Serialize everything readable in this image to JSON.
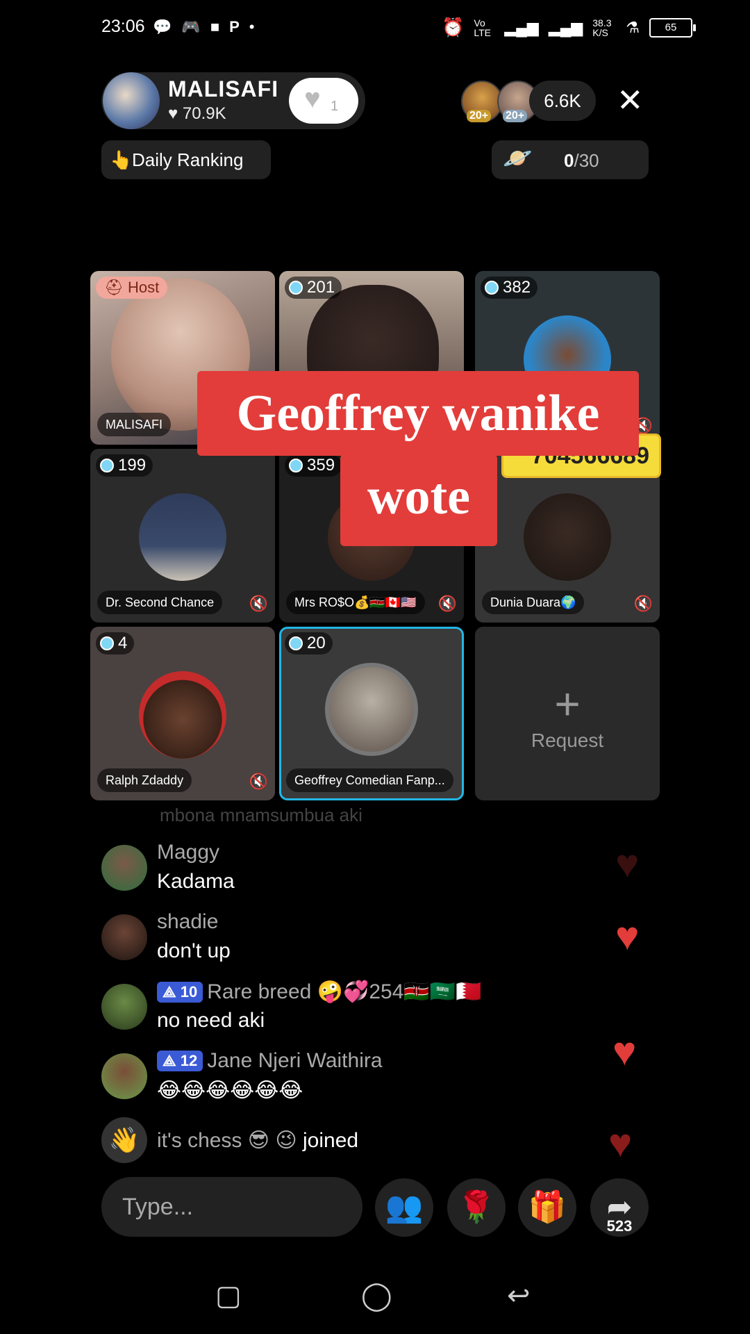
{
  "status_bar": {
    "time": "23:06",
    "left_icons": [
      "messenger-icon",
      "gamepad-icon",
      "video-icon",
      "p-icon",
      "dot-icon"
    ],
    "signal_label": "Vo LTE",
    "data_speed": "38.3 K/S",
    "battery": "65"
  },
  "host": {
    "name": "MALISAFI",
    "likes": "70.9K",
    "like_button_count": "1"
  },
  "viewers": {
    "avatar_levels": [
      "20+",
      "20+"
    ],
    "count": "6.6K"
  },
  "daily_ranking": {
    "emoji": "👆",
    "label": "Daily Ranking"
  },
  "planet_goal": {
    "current": "0",
    "total": "/30"
  },
  "grid": {
    "host_badge": "Host",
    "tiles": [
      {
        "name": "MALISAFI",
        "score": ""
      },
      {
        "name": "",
        "score": "201"
      },
      {
        "name": "",
        "score": "382"
      },
      {
        "name": "Dr. Second Chance",
        "score": "199"
      },
      {
        "name": "Mrs RO$O💰🇰🇪🇨🇦🇺🇸",
        "score": "359"
      },
      {
        "name": "Dunia Duara🌍",
        "score": ""
      },
      {
        "name": "Ralph Zdaddy",
        "score": "4"
      },
      {
        "name": "Geoffrey Comedian Fanp...",
        "score": "20"
      }
    ],
    "request_label": "Request"
  },
  "overlay": {
    "caption_line1": "Geoffrey wanike",
    "caption_line2": "wote",
    "phone_number": "704566689"
  },
  "chat": {
    "faded_line": "mbona mnamsumbua aki",
    "messages": [
      {
        "user": "Maggy",
        "text": "Kadama",
        "level": ""
      },
      {
        "user": "shadie",
        "text": "don't up",
        "level": ""
      },
      {
        "user": "Rare breed 🤪💞254🇰🇪🇸🇦🇧🇭",
        "text": "no need aki",
        "level": "10"
      },
      {
        "user": "Jane Njeri Waithira",
        "text": "😂😂😂😂😂😂",
        "level": "12"
      }
    ],
    "joined": {
      "user": "it's chess 😎 😉",
      "action": "joined"
    }
  },
  "bottom_bar": {
    "input_placeholder": "Type...",
    "share_count": "523"
  },
  "colors": {
    "accent_red": "#e23d3a",
    "selection_blue": "#23b6e5",
    "level_blue": "#3b5bd6"
  }
}
